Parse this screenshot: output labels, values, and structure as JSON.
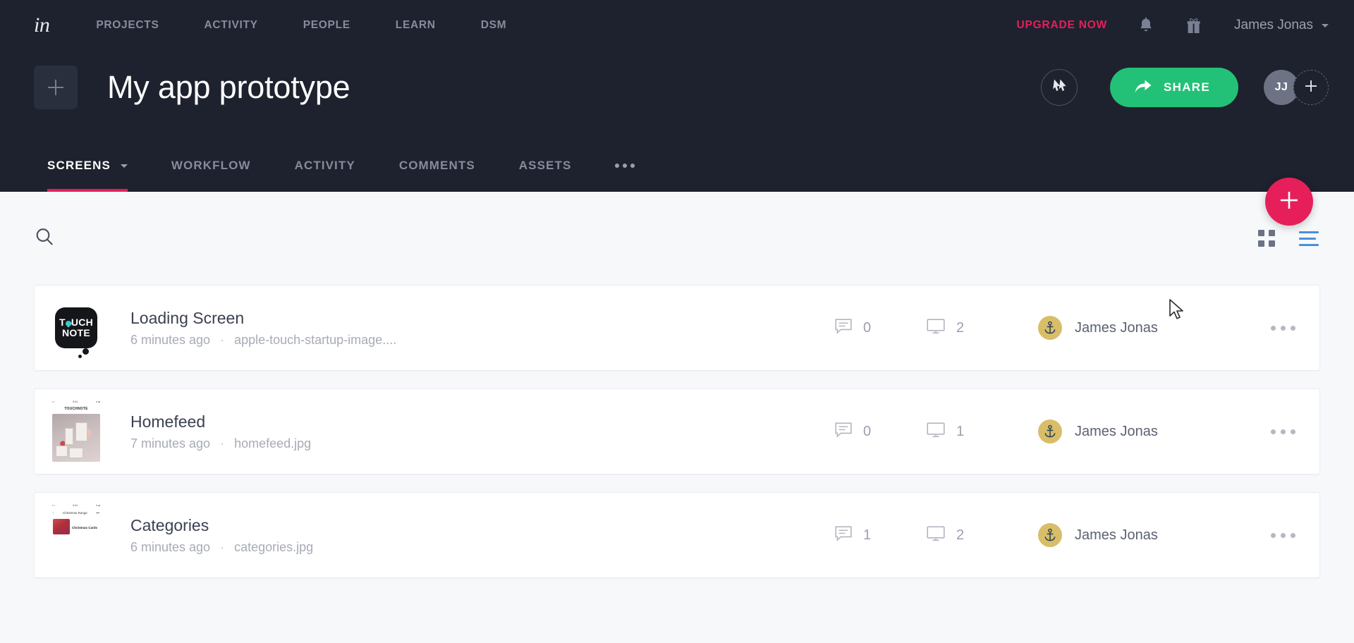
{
  "topnav": {
    "logo": "in",
    "links": [
      {
        "label": "PROJECTS",
        "name": "projects"
      },
      {
        "label": "ACTIVITY",
        "name": "activity"
      },
      {
        "label": "PEOPLE",
        "name": "people"
      },
      {
        "label": "LEARN",
        "name": "learn"
      },
      {
        "label": "DSM",
        "name": "dsm"
      }
    ],
    "upgrade_label": "UPGRADE NOW",
    "upgrade_color": "#e61f5a",
    "notifications_icon": "bell-icon",
    "gifts_icon": "gift-icon",
    "user_name": "James Jonas"
  },
  "project": {
    "add_icon": "plus-icon",
    "title": "My app prototype",
    "preview_icon": "cursor-preview-icon",
    "share_label": "SHARE",
    "share_icon": "share-arrow-icon",
    "share_color": "#23c177",
    "avatar_initials": "JJ",
    "add_member_icon": "plus-icon"
  },
  "tabs": {
    "items": [
      {
        "label": "SCREENS",
        "active": true,
        "has_caret": true,
        "name": "screens"
      },
      {
        "label": "WORKFLOW",
        "active": false,
        "has_caret": false,
        "name": "workflow"
      },
      {
        "label": "ACTIVITY",
        "active": false,
        "has_caret": false,
        "name": "activity"
      },
      {
        "label": "COMMENTS",
        "active": false,
        "has_caret": false,
        "name": "comments"
      },
      {
        "label": "ASSETS",
        "active": false,
        "has_caret": false,
        "name": "assets"
      }
    ],
    "more_icon": "ellipsis-icon",
    "active_underline_color": "#e61f5a"
  },
  "fab": {
    "icon": "plus-icon",
    "color": "#e61f5a"
  },
  "toolbar": {
    "search_icon": "search-icon",
    "search_value": "",
    "search_placeholder": "",
    "grid_view_icon": "grid-view-icon",
    "list_view_icon": "list-view-icon",
    "active_view": "list",
    "active_view_color": "#4a90d9"
  },
  "screens": {
    "comment_icon": "comment-icon",
    "screen_icon": "monitor-icon",
    "row_more_icon": "ellipsis-icon",
    "rows": [
      {
        "title": "Loading Screen",
        "time": "6 minutes ago",
        "separator": "·",
        "filename": "apple-touch-startup-image....",
        "comments": "0",
        "views": "2",
        "author": "James Jonas",
        "thumb_type": "touchnote-logo",
        "thumb_text_top": "T UCH",
        "thumb_text_bottom": "NOTE"
      },
      {
        "title": "Homefeed",
        "time": "7 minutes ago",
        "separator": "·",
        "filename": "homefeed.jpg",
        "comments": "0",
        "views": "1",
        "author": "James Jonas",
        "thumb_type": "phone-photo",
        "thumb_app_title": "TOUCHNOTE"
      },
      {
        "title": "Categories",
        "time": "6 minutes ago",
        "separator": "·",
        "filename": "categories.jpg",
        "comments": "1",
        "views": "2",
        "author": "James Jonas",
        "thumb_type": "phone-categories",
        "thumb_nav_title": "Christmas Range",
        "thumb_item_title": "Christmas Cards"
      }
    ]
  }
}
